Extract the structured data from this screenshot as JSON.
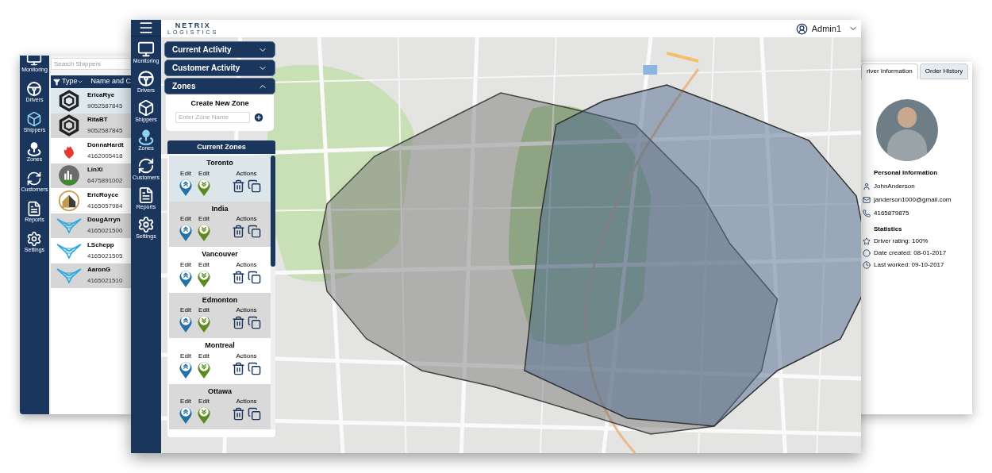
{
  "shippers_window": {
    "sidebar": [
      {
        "kind": "monitor",
        "label": "Monitoring",
        "selected": false
      },
      {
        "kind": "wheel",
        "label": "Drivers",
        "selected": false
      },
      {
        "kind": "box",
        "label": "Shippers",
        "selected": true
      },
      {
        "kind": "pin",
        "label": "Zones",
        "selected": false
      },
      {
        "kind": "cycle",
        "label": "Customers",
        "selected": false
      },
      {
        "kind": "report",
        "label": "Reports",
        "selected": false
      },
      {
        "kind": "gear",
        "label": "Settings",
        "selected": false
      }
    ],
    "search": {
      "placeholder": "Search Shippers"
    },
    "columns": [
      "Type",
      "Name and C"
    ],
    "rows": [
      {
        "kind": "hexagon",
        "name": "EricaRye",
        "phone": "9052587845",
        "selected": true
      },
      {
        "kind": "hexagon",
        "name": "RitaBT",
        "phone": "9052587845",
        "selected": false
      },
      {
        "kind": "flame",
        "name": "DonnaHardt",
        "phone": "4162005418",
        "selected": false
      },
      {
        "kind": "city",
        "name": "LinXi",
        "phone": "6475891002",
        "selected": false
      },
      {
        "kind": "house",
        "name": "EricRoyce",
        "phone": "4165057984",
        "selected": false
      },
      {
        "kind": "wings",
        "name": "DougArryn",
        "phone": "4165021500",
        "selected": false
      },
      {
        "kind": "wings",
        "name": "LSchepp",
        "phone": "4165021505",
        "selected": false
      },
      {
        "kind": "wings",
        "name": "AaronG",
        "phone": "4165021510",
        "selected": false
      }
    ]
  },
  "main_window": {
    "logo": {
      "name": "NETRIX",
      "tagline": "LOGISTICS"
    },
    "user": "Admin1",
    "sidebar": [
      {
        "kind": "monitor",
        "label": "Monitoring",
        "selected": false
      },
      {
        "kind": "wheel",
        "label": "Drivers",
        "selected": false
      },
      {
        "kind": "box",
        "label": "Shippers",
        "selected": false
      },
      {
        "kind": "pin",
        "label": "Zones",
        "selected": true
      },
      {
        "kind": "cycle",
        "label": "Customers",
        "selected": false
      },
      {
        "kind": "report",
        "label": "Reports",
        "selected": false
      },
      {
        "kind": "gear",
        "label": "Settings",
        "selected": false
      }
    ],
    "accordion": [
      {
        "label": "Current Activity",
        "expanded": false
      },
      {
        "label": "Customer Activity",
        "expanded": false
      },
      {
        "label": "Zones",
        "expanded": true
      }
    ],
    "create_zone": {
      "title": "Create New Zone",
      "placeholder": "Enter Zone Name"
    },
    "current_zones": {
      "title": "Current Zones",
      "zones": [
        {
          "name": "Toronto",
          "edit_labels": [
            "Edit",
            "Edit"
          ],
          "actions_label": "Actions",
          "selected": true
        },
        {
          "name": "India",
          "edit_labels": [
            "Edit",
            "Edit"
          ],
          "actions_label": "Actions",
          "selected": false
        },
        {
          "name": "Vancouver",
          "edit_labels": [
            "Edit",
            "Edit"
          ],
          "actions_label": "Actions",
          "selected": false
        },
        {
          "name": "Edmonton",
          "edit_labels": [
            "Edit",
            "Edit"
          ],
          "actions_label": "Actions",
          "selected": false
        },
        {
          "name": "Montreal",
          "edit_labels": [
            "Edit",
            "Edit"
          ],
          "actions_label": "Actions",
          "selected": false
        },
        {
          "name": "Ottawa",
          "edit_labels": [
            "Edit",
            "Edit"
          ],
          "actions_label": "Actions",
          "selected": false
        }
      ]
    }
  },
  "driver_window": {
    "tabs": [
      {
        "label": "river Information",
        "selected": true
      },
      {
        "label": "Order History",
        "selected": false
      }
    ],
    "personal_title": "Personal Information",
    "personal": [
      {
        "kind": "user",
        "text": "JohnAnderson"
      },
      {
        "kind": "mail",
        "text": "janderson1000@gmail.com"
      },
      {
        "kind": "phone",
        "text": "4165879875"
      }
    ],
    "stats_title": "Statistics",
    "stats": [
      {
        "kind": "star",
        "text": "Driver rating: 100%"
      },
      {
        "kind": "circle",
        "text": "Date created: 08-01-2017"
      },
      {
        "kind": "clock",
        "text": "Last worked: 09-10-2017"
      }
    ]
  }
}
